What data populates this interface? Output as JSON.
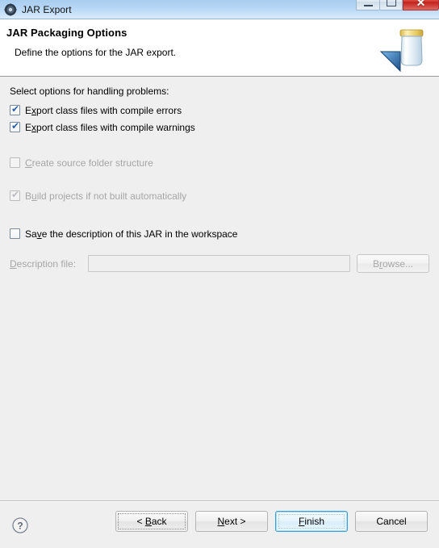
{
  "window": {
    "title": "JAR Export",
    "icon": "eclipse-jar-icon",
    "controls": {
      "minimize": "minimize-icon",
      "maximize": "maximize-icon",
      "close": "✕"
    }
  },
  "header": {
    "title": "JAR Packaging Options",
    "description": "Define the options for the JAR export.",
    "graphic": "jar-export-banner-icon"
  },
  "body": {
    "intro_label": "Select options for handling problems:",
    "options": [
      {
        "label_pre": "E",
        "label_mnemonic": "x",
        "label_post": "port class files with compile errors",
        "checked": true,
        "enabled": true,
        "name": "checkbox-export-compile-errors"
      },
      {
        "label_pre": "E",
        "label_mnemonic": "x",
        "label_post": "port class files with compile warnings",
        "checked": true,
        "enabled": true,
        "name": "checkbox-export-compile-warnings"
      },
      {
        "label_pre": "",
        "label_mnemonic": "C",
        "label_post": "reate source folder structure",
        "checked": false,
        "enabled": false,
        "name": "checkbox-create-source-folder-structure"
      },
      {
        "label_pre": "B",
        "label_mnemonic": "u",
        "label_post": "ild projects if not built automatically",
        "checked": true,
        "enabled": false,
        "name": "checkbox-build-projects-if-not-built"
      },
      {
        "label_pre": "Sa",
        "label_mnemonic": "v",
        "label_post": "e the description of this JAR in the workspace",
        "checked": false,
        "enabled": true,
        "name": "checkbox-save-description"
      }
    ],
    "description_file": {
      "label_mnemonic": "D",
      "label_pre": "",
      "label_post": "escription file:",
      "value": "",
      "placeholder": "",
      "browse_pre": "B",
      "browse_mnemonic": "r",
      "browse_post": "owse..."
    }
  },
  "footer": {
    "help": "help-icon",
    "buttons": [
      {
        "pre": "< ",
        "mnemonic": "B",
        "post": "ack",
        "name": "back-button",
        "state": "focused"
      },
      {
        "pre": "",
        "mnemonic": "N",
        "post": "ext >",
        "name": "next-button",
        "state": "normal"
      },
      {
        "pre": "",
        "mnemonic": "F",
        "post": "inish",
        "name": "finish-button",
        "state": "default"
      },
      {
        "pre": "",
        "mnemonic": "",
        "post": "Cancel",
        "name": "cancel-button",
        "state": "normal"
      }
    ]
  },
  "colors": {
    "titlebar": "#b6d6f4",
    "body": "#efefef",
    "header": "#ffffff",
    "accent": "#3c9ed6",
    "close": "#d9443c",
    "checkmark": "#2c5fa8",
    "disabled_text": "#a6a6a6"
  }
}
